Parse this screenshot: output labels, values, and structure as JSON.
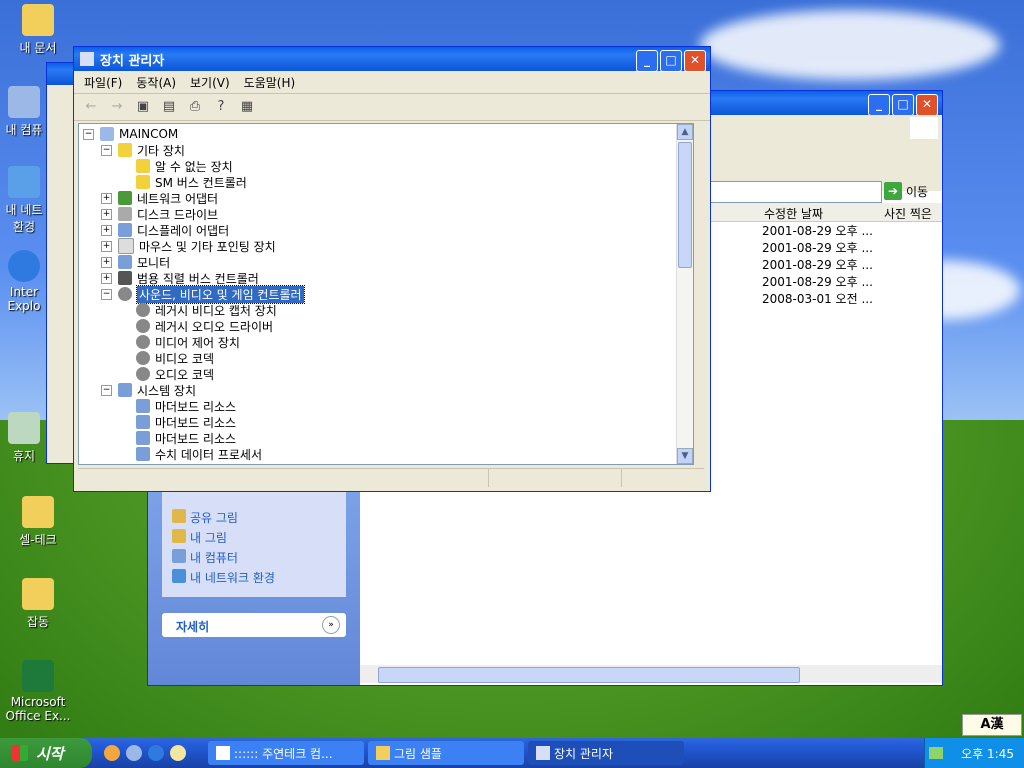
{
  "desktop": {
    "icons": [
      {
        "label": "내 문서"
      },
      {
        "label": "내 컴퓨"
      },
      {
        "label": "내 네트 환경"
      },
      {
        "label": "Inter Explo"
      },
      {
        "label": "휴지"
      },
      {
        "label": "셀-테크"
      },
      {
        "label": "잡동"
      },
      {
        "label": "Microsoft Office Ex..."
      }
    ]
  },
  "devmgr": {
    "title": "장치 관리자",
    "menu": [
      "파일(F)",
      "동작(A)",
      "보기(V)",
      "도움말(H)"
    ],
    "tree": {
      "root": "MAINCOM",
      "other_devices": "기타 장치",
      "unknown_device": "알 수 없는 장치",
      "smbus": "SM 버스 컨트롤러",
      "network": "네트워크 어댑터",
      "disk": "디스크 드라이브",
      "display": "디스플레이 어댑터",
      "mouse": "마우스 및 기타 포인팅 장치",
      "monitor": "모니터",
      "usb": "범용 직렬 버스 컨트롤러",
      "sound": "사운드, 비디오 및 게임 컨트롤러",
      "legacy_video": "레거시 비디오 캡처 장치",
      "legacy_audio": "레거시 오디오 드라이버",
      "media_control": "미디어 제어 장치",
      "video_codec": "비디오 코덱",
      "audio_codec": "오디오 코덱",
      "system": "시스템 장치",
      "mb1": "마더보드 리소스",
      "mb2": "마더보드 리소스",
      "mb3": "마더보드 리소스",
      "numeric": "수치 데이터 프로세서"
    }
  },
  "explorer": {
    "go_label": "이동",
    "col_modified": "수정한 날짜",
    "col_taken": "사진 찍은",
    "dates": [
      "2001-08-29 오후 ...",
      "2001-08-29 오후 ...",
      "2001-08-29 오후 ...",
      "2001-08-29 오후 ...",
      "2008-03-01 오전 ..."
    ],
    "links": [
      "공유 그림",
      "내 그림",
      "내 컴퓨터",
      "내 네트워크 환경"
    ],
    "details_label": "자세히"
  },
  "taskbar": {
    "start_label": "시작",
    "tasks": [
      ":::::: 주연테크 컴...",
      "그림 샘플",
      "장치 관리자"
    ],
    "clock": "오후 1:45",
    "ime": "A漢"
  }
}
